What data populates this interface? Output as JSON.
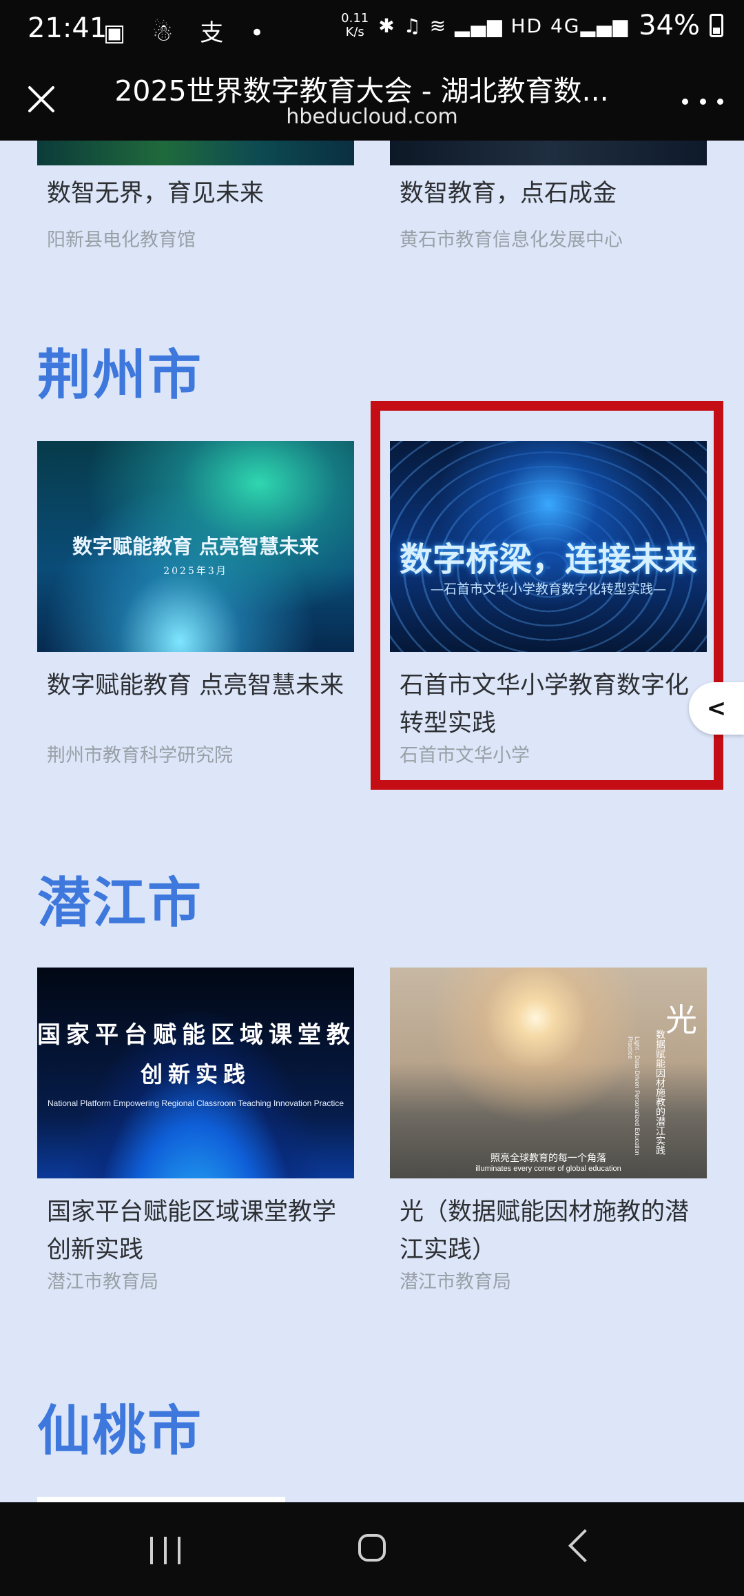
{
  "status_bar": {
    "time": "21:41",
    "left_icons": "▣ ☃ 支 •",
    "net_speed_value": "0.11",
    "net_speed_unit": "K/s",
    "signal": "✱ ♫ ≋ ▂▄▆ HD 4G▂▄▆",
    "battery": "34%"
  },
  "browser": {
    "title": "2025世界数字教育大会 - 湖北教育数...",
    "url": "hbeducloud.com"
  },
  "top_cards": [
    {
      "title": "数智无界，育见未来",
      "org": "阳新县电化教育馆"
    },
    {
      "title": "数智教育，点石成金",
      "org": "黄石市教育信息化发展中心"
    }
  ],
  "sections": [
    {
      "city": "荆州市",
      "cards": [
        {
          "title": "数字赋能教育 点亮智慧未来",
          "org": "荆州市教育科学研究院",
          "thumb_main": "数字赋能教育 点亮智慧未来",
          "thumb_sub": "2025年3月"
        },
        {
          "title": "石首市文华小学教育数字化转型实践",
          "org": "石首市文华小学",
          "thumb_main": "数字桥梁，连接未来",
          "thumb_sub": "—石首市文华小学教育数字化转型实践—"
        }
      ]
    },
    {
      "city": "潜江市",
      "cards": [
        {
          "title": "国家平台赋能区域课堂教学创新实践",
          "org": "潜江市教育局",
          "thumb_main": "国家平台赋能区域课堂教学",
          "thumb_main2": "创新实践",
          "thumb_sub": "National Platform Empowering Regional Classroom Teaching Innovation Practice"
        },
        {
          "title": "光（数据赋能因材施教的潜江实践）",
          "org": "潜江市教育局",
          "thumb_main": "光",
          "thumb_side": "数据赋能因材施教的潜江实践",
          "thumb_side_en": "Light · Data-Driven Personalized Education Practice",
          "thumb_caption": "照亮全球教育的每一个角落",
          "thumb_caption_en": "illuminates every corner of global education"
        }
      ]
    },
    {
      "city": "仙桃市"
    }
  ],
  "side_tab": {
    "label": "<"
  },
  "colors": {
    "accent": "#3e78dc",
    "highlight": "#c40d14",
    "background": "#dce6f8"
  }
}
